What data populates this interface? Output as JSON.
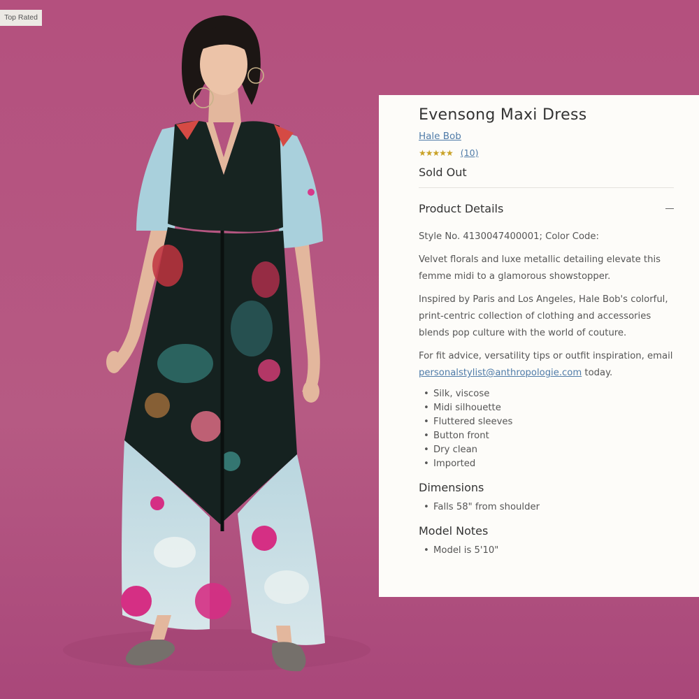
{
  "badge": "Top Rated",
  "product": {
    "title": "Evensong Maxi Dress",
    "brand": "Hale Bob",
    "rating": 4.5,
    "stars": "★★★★★",
    "review_count": "(10)",
    "availability": "Sold Out"
  },
  "details": {
    "heading": "Product Details",
    "style_no": "Style No. 4130047400001; Color Code:",
    "para1": "Velvet florals and luxe metallic detailing elevate this femme midi to a glamorous showstopper.",
    "para2": "Inspired by Paris and Los Angeles, Hale Bob's colorful, print-centric collection of clothing and accessories blends pop culture with the world of couture.",
    "para3_prefix": "For fit advice, versatility tips or outfit inspiration, email",
    "email": "personalstylist@anthropologie.com",
    "para3_suffix": " today.",
    "features": [
      "Silk, viscose",
      "Midi silhouette",
      "Fluttered sleeves",
      "Button front",
      "Dry clean",
      "Imported"
    ]
  },
  "dimensions": {
    "heading": "Dimensions",
    "items": [
      "Falls 58\" from shoulder"
    ]
  },
  "model_notes": {
    "heading": "Model Notes",
    "items": [
      "Model is 5'10\""
    ]
  },
  "colors": {
    "background": "#b65a83",
    "panel": "#fdfcf9",
    "link": "#4f7ba8",
    "star": "#c9a227"
  }
}
